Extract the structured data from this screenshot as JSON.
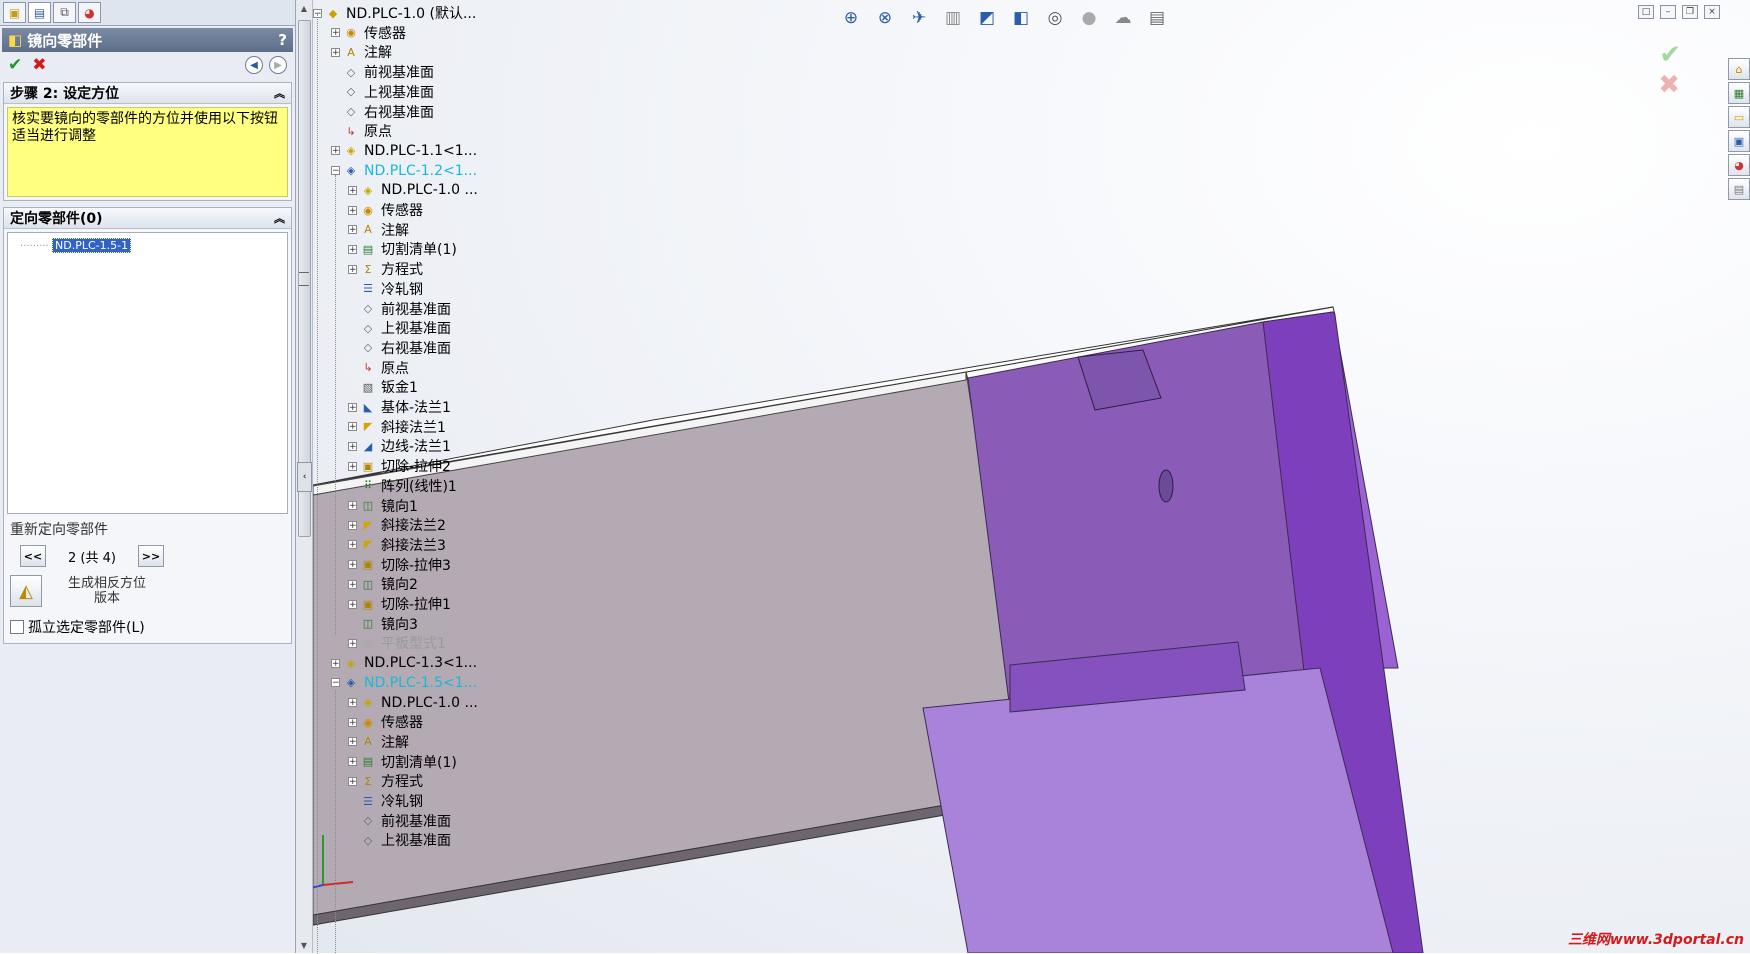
{
  "left_panel": {
    "tabs": [
      "feature-manager",
      "property-manager",
      "configuration-manager",
      "display-manager"
    ],
    "title": "镜向零部件",
    "help": "?",
    "ok": "✔",
    "cancel": "✖",
    "step_group": {
      "title": "步骤 2: 设定方位",
      "message": "核实要镜向的零部件的方位并使用以下按钮适当进行调整"
    },
    "orient_group": {
      "title": "定向零部件(0)",
      "selected_item": "ND.PLC-1.5-1",
      "reorient_label": "重新定向零部件",
      "prev": "<<",
      "next": ">>",
      "page_text": "2 (共 4)",
      "generate_label_1": "生成相反方位",
      "generate_label_2": "版本",
      "isolate_label": "孤立选定零部件(L)"
    }
  },
  "tree": {
    "nodes": [
      {
        "label": "ND.PLC-1.0  (默认...",
        "level": 0,
        "icon": "assembly",
        "expander": "−"
      },
      {
        "label": "传感器",
        "level": 1,
        "icon": "sensor",
        "expander": "+"
      },
      {
        "label": "注解",
        "level": 1,
        "icon": "annotation",
        "expander": "+"
      },
      {
        "label": "前视基准面",
        "level": 1,
        "icon": "plane",
        "expander": ""
      },
      {
        "label": "上视基准面",
        "level": 1,
        "icon": "plane",
        "expander": ""
      },
      {
        "label": "右视基准面",
        "level": 1,
        "icon": "plane",
        "expander": ""
      },
      {
        "label": "原点",
        "level": 1,
        "icon": "origin",
        "expander": ""
      },
      {
        "label": "ND.PLC-1.1<1...",
        "level": 1,
        "icon": "part",
        "expander": "+"
      },
      {
        "label": "ND.PLC-1.2<1...",
        "level": 1,
        "icon": "part-blue",
        "expander": "−",
        "style": "cyan"
      },
      {
        "label": "ND.PLC-1.0 ...",
        "level": 2,
        "icon": "part",
        "expander": "+"
      },
      {
        "label": "传感器",
        "level": 2,
        "icon": "sensor",
        "expander": "+"
      },
      {
        "label": "注解",
        "level": 2,
        "icon": "annotation",
        "expander": "+"
      },
      {
        "label": "切割清单(1)",
        "level": 2,
        "icon": "cutlist",
        "expander": "+"
      },
      {
        "label": "方程式",
        "level": 2,
        "icon": "equation",
        "expander": "+"
      },
      {
        "label": "冷轧钢",
        "level": 2,
        "icon": "material",
        "expander": ""
      },
      {
        "label": "前视基准面",
        "level": 2,
        "icon": "plane",
        "expander": ""
      },
      {
        "label": "上视基准面",
        "level": 2,
        "icon": "plane",
        "expander": ""
      },
      {
        "label": "右视基准面",
        "level": 2,
        "icon": "plane",
        "expander": ""
      },
      {
        "label": "原点",
        "level": 2,
        "icon": "origin",
        "expander": ""
      },
      {
        "label": "钣金1",
        "level": 2,
        "icon": "sheetmetal",
        "expander": ""
      },
      {
        "label": "基体-法兰1",
        "level": 2,
        "icon": "flange",
        "expander": "+"
      },
      {
        "label": "斜接法兰1",
        "level": 2,
        "icon": "miter",
        "expander": "+"
      },
      {
        "label": "边线-法兰1",
        "level": 2,
        "icon": "edgeflange",
        "expander": "+"
      },
      {
        "label": "切除-拉伸2",
        "level": 2,
        "icon": "cut",
        "expander": "+"
      },
      {
        "label": "阵列(线性)1",
        "level": 2,
        "icon": "pattern",
        "expander": ""
      },
      {
        "label": "镜向1",
        "level": 2,
        "icon": "mirror",
        "expander": "+"
      },
      {
        "label": "斜接法兰2",
        "level": 2,
        "icon": "miter",
        "expander": "+"
      },
      {
        "label": "斜接法兰3",
        "level": 2,
        "icon": "miter",
        "expander": "+"
      },
      {
        "label": "切除-拉伸3",
        "level": 2,
        "icon": "cut",
        "expander": "+"
      },
      {
        "label": "镜向2",
        "level": 2,
        "icon": "mirror",
        "expander": "+"
      },
      {
        "label": "切除-拉伸1",
        "level": 2,
        "icon": "cut",
        "expander": "+"
      },
      {
        "label": "镜向3",
        "level": 2,
        "icon": "mirror",
        "expander": ""
      },
      {
        "label": "平板型式1",
        "level": 2,
        "icon": "flat",
        "expander": "+",
        "style": "grey"
      },
      {
        "label": "ND.PLC-1.3<1...",
        "level": 1,
        "icon": "part",
        "expander": "+"
      },
      {
        "label": "ND.PLC-1.5<1...",
        "level": 1,
        "icon": "part-blue",
        "expander": "−",
        "style": "cyan"
      },
      {
        "label": "ND.PLC-1.0 ...",
        "level": 2,
        "icon": "part",
        "expander": "+"
      },
      {
        "label": "传感器",
        "level": 2,
        "icon": "sensor",
        "expander": "+"
      },
      {
        "label": "注解",
        "level": 2,
        "icon": "annotation",
        "expander": "+"
      },
      {
        "label": "切割清单(1)",
        "level": 2,
        "icon": "cutlist",
        "expander": "+"
      },
      {
        "label": "方程式",
        "level": 2,
        "icon": "equation",
        "expander": "+"
      },
      {
        "label": "冷轧钢",
        "level": 2,
        "icon": "material",
        "expander": ""
      },
      {
        "label": "前视基准面",
        "level": 2,
        "icon": "plane",
        "expander": ""
      },
      {
        "label": "上视基准面",
        "level": 2,
        "icon": "plane",
        "expander": ""
      }
    ]
  },
  "view_toolbar": [
    "zoom-to-fit-icon",
    "zoom-to-area-icon",
    "previous-view-icon",
    "section-view-icon",
    "view-orientation-icon",
    "display-style-icon",
    "hide-show-items-icon",
    "edit-appearance-icon",
    "apply-scene-icon",
    "view-settings-icon"
  ],
  "task_pane": [
    "home-icon",
    "design-library-icon",
    "file-explorer-icon",
    "view-palette-icon",
    "appearances-icon",
    "custom-properties-icon"
  ],
  "confirm": {
    "ok": "✔",
    "cancel": "✖"
  },
  "watermark": "三维网www.3dportal.cn",
  "colors": {
    "part_purple": "#8f5cc4",
    "part_grey": "#b3aab4",
    "title_bar": "#5d6e89",
    "message_yellow": "#ffff80",
    "selected_cyan": "#19b8d6"
  }
}
